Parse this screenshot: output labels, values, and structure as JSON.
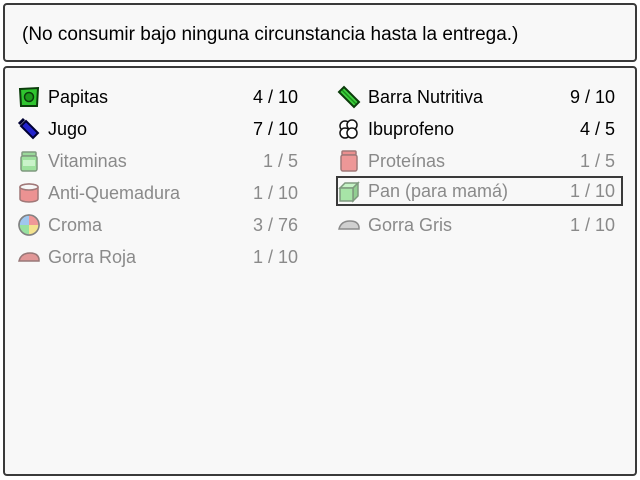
{
  "help": {
    "text": "(No consumir bajo ninguna circunstancia hasta la entrega.)"
  },
  "items": [
    {
      "name": "Papitas",
      "count": "4 / 10",
      "icon": "chip-bag-icon",
      "enabled": true
    },
    {
      "name": "Barra Nutritiva",
      "count": "9 / 10",
      "icon": "nutrition-bar-icon",
      "enabled": true
    },
    {
      "name": "Jugo",
      "count": "7 / 10",
      "icon": "juice-bottle-icon",
      "enabled": true
    },
    {
      "name": "Ibuprofeno",
      "count": "4 / 5",
      "icon": "pills-icon",
      "enabled": true
    },
    {
      "name": "Vitaminas",
      "count": "1 / 5",
      "icon": "vitamin-jar-icon",
      "enabled": false
    },
    {
      "name": "Proteínas",
      "count": "1 / 5",
      "icon": "protein-jar-icon",
      "enabled": false
    },
    {
      "name": "Anti-Quemadura",
      "count": "1 / 10",
      "icon": "burn-cream-icon",
      "enabled": false
    },
    {
      "name": "Pan (para mamá)",
      "count": "1 / 10",
      "icon": "bread-box-icon",
      "enabled": false,
      "selected": true
    },
    {
      "name": "Croma",
      "count": "3 / 76",
      "icon": "chroma-orb-icon",
      "enabled": false
    },
    {
      "name": "Gorra Gris",
      "count": "1 / 10",
      "icon": "gray-cap-icon",
      "enabled": false
    },
    {
      "name": "Gorra Roja",
      "count": "1 / 10",
      "icon": "red-cap-icon",
      "enabled": false
    }
  ]
}
